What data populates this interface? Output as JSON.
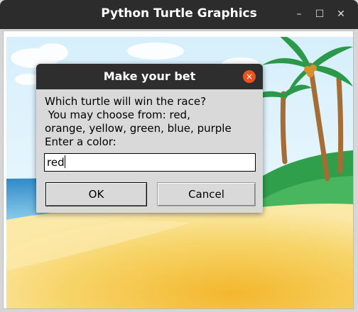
{
  "window": {
    "title": "Python Turtle Graphics",
    "minimize_glyph": "–",
    "maximize_glyph": "☐",
    "close_glyph": "✕"
  },
  "canvas": {
    "background": "beach-scene",
    "colors": {
      "sky": "#e8f6fd",
      "sea": "#2f8ec8",
      "sand": "#f4c84a",
      "palm_leaf": "#2a9a4a",
      "palm_trunk": "#b07a3a"
    }
  },
  "dialog": {
    "title": "Make your bet",
    "close_glyph": "×",
    "prompt": "Which turtle will win the race?\n You may choose from: red,\norange, yellow, green, blue, purple\nEnter a color:",
    "input_value": "red",
    "ok_label": "OK",
    "cancel_label": "Cancel",
    "accent_color": "#e95420"
  }
}
